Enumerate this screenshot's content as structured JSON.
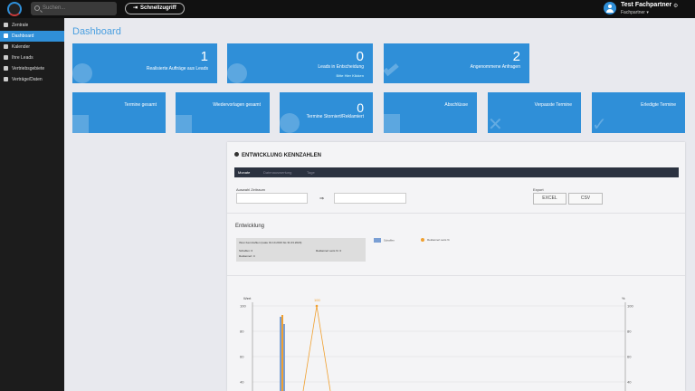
{
  "topbar": {
    "search_placeholder": "Suchen...",
    "quick_access": "Schnellzugriff",
    "user_name": "Test Fachpartner",
    "user_role": "Fachpartner ▾"
  },
  "sidebar": {
    "items": [
      {
        "label": "Zentrale",
        "icon": "bell-icon",
        "active": false
      },
      {
        "label": "Dashboard",
        "icon": "dashboard-icon",
        "active": true
      },
      {
        "label": "Kalender",
        "icon": "calendar-icon",
        "active": false
      },
      {
        "label": "Ihre Leads",
        "icon": "users-icon",
        "active": false
      },
      {
        "label": "Vertriebsgebiete",
        "icon": "map-pin-icon",
        "active": false
      },
      {
        "label": "Verträge/Daten",
        "icon": "document-icon",
        "active": false
      }
    ]
  },
  "page_title": "Dashboard",
  "cards_top": [
    {
      "value": "1",
      "label": "Realisierte Aufträge aus Leads",
      "sub": "",
      "icon": "money-icon"
    },
    {
      "value": "0",
      "label": "Leads in Entscheidung",
      "sub": "Bitte Hier Klicken",
      "icon": "gear-icon"
    },
    {
      "value": "2",
      "label": "Angenommene Anfragen",
      "sub": "",
      "icon": "check-icon"
    }
  ],
  "cards_bottom": [
    {
      "value": "",
      "label": "Termine gesamt",
      "icon": "calendar-icon"
    },
    {
      "value": "",
      "label": "Wiedervorlagen gesamt",
      "icon": "calendar-icon"
    },
    {
      "value": "0",
      "label": "Termine Storniert/Reklamiert",
      "icon": "user-x-icon"
    },
    {
      "value": "",
      "label": "Abschlüsse",
      "icon": "document-icon"
    },
    {
      "value": "",
      "label": "Verpasste Termine",
      "icon": "x-icon"
    },
    {
      "value": "",
      "label": "Erledigte Termine",
      "icon": "check-icon"
    }
  ],
  "panel": {
    "title": "ENTWICKLUNG KENNZAHLEN",
    "tabs": [
      "Monate",
      "Datenauswertung",
      "Tage"
    ],
    "date_label": "Auswahl Zeitraum",
    "date_sep": "⇒",
    "export_label": "Export",
    "export_buttons": [
      "EXCEL",
      "CSV"
    ],
    "section": "Entwicklung",
    "info_title": "Ihren Kennzahlen (reale 01.10.2016 bis 31.03.2020)",
    "info_items": [
      "Schaffen: 6",
      "Reklamiert: 0",
      "Reklamiert seits %: 0"
    ]
  },
  "chart_data": {
    "type": "bar",
    "legend": [
      "Schaffen",
      "Reklamiert seits %"
    ],
    "ylabel_left": "Wert",
    "ylabel_right": "%",
    "yticks_left": [
      100,
      80,
      60,
      40
    ],
    "yticks_right": [
      100,
      80,
      60,
      40
    ],
    "peak_label": "100",
    "colors": {
      "bars": "#7a9fd4",
      "line": "#f0a030"
    }
  },
  "colors": {
    "accent": "#2f8fd8",
    "sidebar": "#1c1c1c",
    "topbar": "#111111"
  }
}
